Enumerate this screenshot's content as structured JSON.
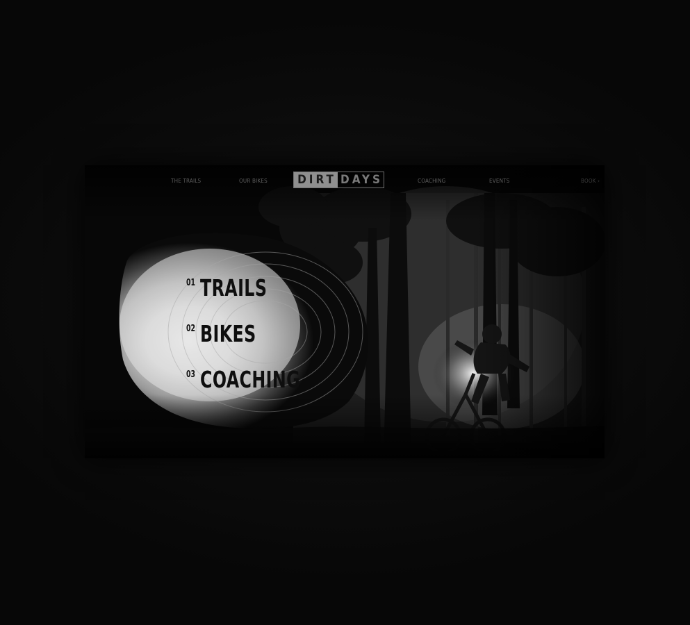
{
  "nav": {
    "left_links": [
      "THE TRAILS",
      "OUR BIKES"
    ],
    "right_links": [
      "COACHING",
      "EVENTS"
    ],
    "corner_link": "BOOK ›"
  },
  "logo": {
    "part_a": "DIRT",
    "part_b": "DAYS"
  },
  "menu": [
    {
      "num": "01",
      "label": "TRAILS"
    },
    {
      "num": "02",
      "label": "BIKES"
    },
    {
      "num": "03",
      "label": "COACHING"
    }
  ],
  "colors": {
    "background": "#0b0b0b",
    "hero_dark": "#050505",
    "fog": "#d8d8d8",
    "menu_text": "#0e0e0e",
    "nav_text": "#5e5e5e"
  },
  "icons": [
    "rider-illustration"
  ]
}
